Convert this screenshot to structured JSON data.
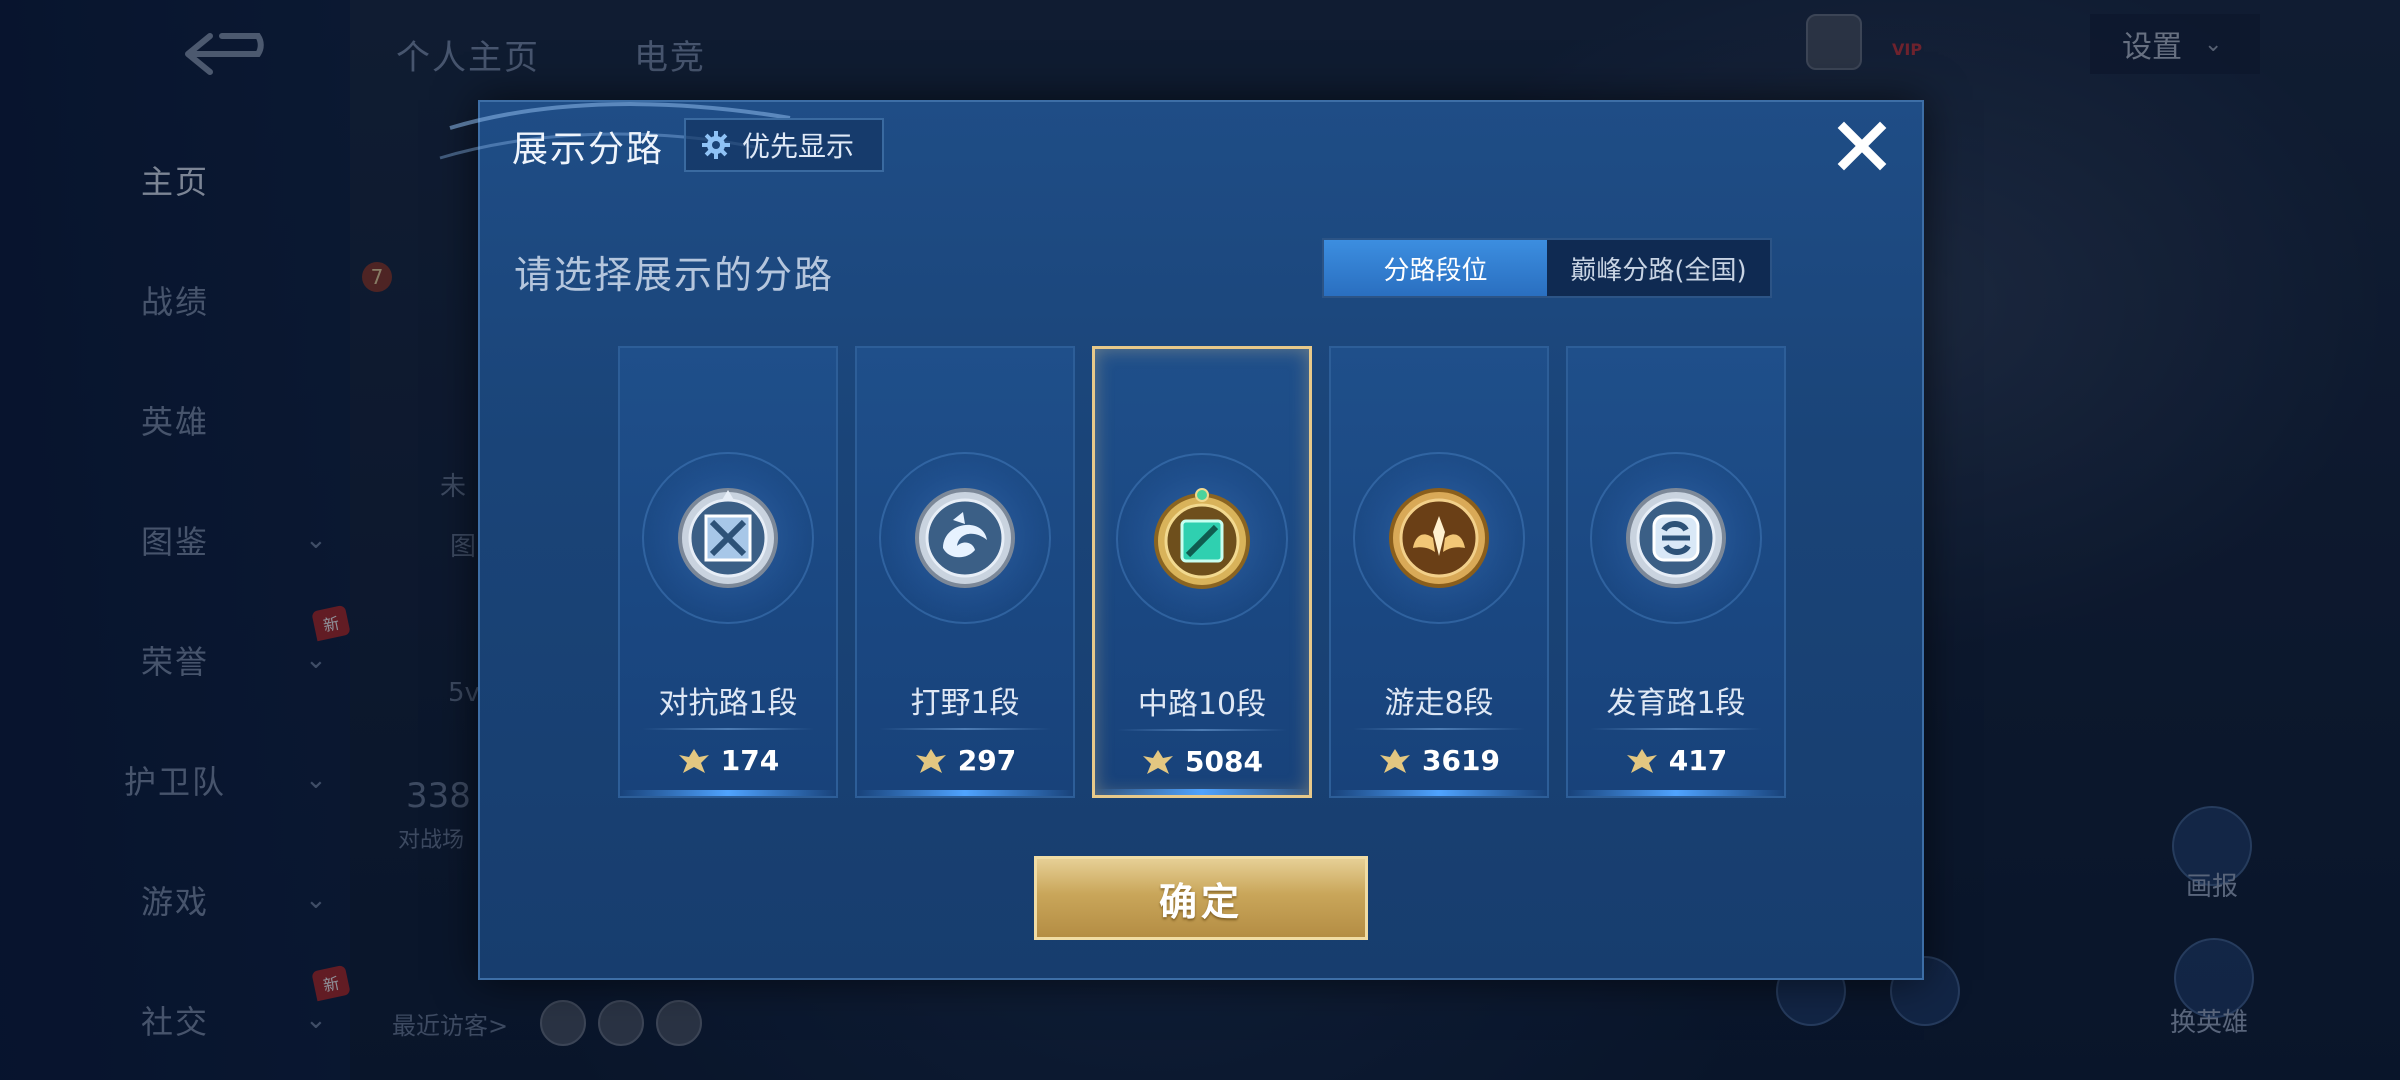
{
  "background": {
    "back_icon": "back-arrow-icon",
    "top_tabs": [
      "个人主页",
      "电竞"
    ],
    "sidebar": [
      {
        "label": "主页",
        "active": true,
        "chevron": false,
        "new": false
      },
      {
        "label": "战绩",
        "active": false,
        "chevron": false,
        "new": false
      },
      {
        "label": "英雄",
        "active": false,
        "chevron": false,
        "new": false
      },
      {
        "label": "图鉴",
        "active": false,
        "chevron": true,
        "new": false
      },
      {
        "label": "荣誉",
        "active": false,
        "chevron": true,
        "new": true
      },
      {
        "label": "护卫队",
        "active": false,
        "chevron": true,
        "new": false
      },
      {
        "label": "游戏",
        "active": false,
        "chevron": true,
        "new": false
      },
      {
        "label": "社交",
        "active": false,
        "chevron": true,
        "new": true
      }
    ],
    "new_badge": "新",
    "settings_label": "设置",
    "recent_visitors": "最近访客>",
    "partial_texts": {
      "level": "7",
      "unrated": "未",
      "img_tab": "图",
      "mode": "5v",
      "count": "338",
      "count_label": "对战场"
    },
    "bottom_right": {
      "poster_label": "画报",
      "switch_hero_label": "换英雄"
    },
    "vip_label": "VIP"
  },
  "modal": {
    "title": "展示分路",
    "priority_button": {
      "icon": "gear-icon",
      "label": "优先显示"
    },
    "close_icon": "close-icon",
    "subtitle": "请选择展示的分路",
    "toggle": [
      {
        "label": "分路段位",
        "active": true
      },
      {
        "label": "巅峰分路(全国)",
        "active": false
      }
    ],
    "lanes": [
      {
        "rank": "对抗路1段",
        "score": "174",
        "icon": "clash-lane-icon",
        "tier": "silver",
        "selected": false
      },
      {
        "rank": "打野1段",
        "score": "297",
        "icon": "jungle-icon",
        "tier": "silver",
        "selected": false
      },
      {
        "rank": "中路10段",
        "score": "5084",
        "icon": "mid-lane-icon",
        "tier": "jade",
        "selected": true
      },
      {
        "rank": "游走8段",
        "score": "3619",
        "icon": "roam-icon",
        "tier": "gold",
        "selected": false
      },
      {
        "rank": "发育路1段",
        "score": "417",
        "icon": "farm-lane-icon",
        "tier": "silver",
        "selected": false
      }
    ],
    "score_icon": "power-crest-icon",
    "confirm_label": "确定"
  },
  "colors": {
    "accent_blue": "#2a6fc0",
    "selected_border": "#e7c98a",
    "confirm_gold": "#c9a65a"
  }
}
